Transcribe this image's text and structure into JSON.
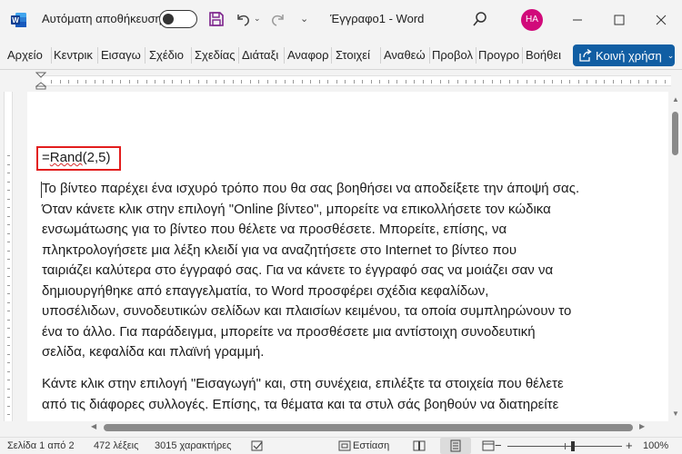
{
  "titlebar": {
    "autosave_label": "Αυτόματη αποθήκευση",
    "doc_title": "Έγγραφο1  -  Word",
    "avatar_initials": "HA",
    "avatar_color": "#d10a7a"
  },
  "ribbon": {
    "tabs": [
      "Αρχείο",
      "Κεντρικ",
      "Εισαγω",
      "Σχέδιο",
      "Σχεδίας",
      "Διάταξι",
      "Αναφορ",
      "Στοιχεί",
      "Αναθεώ",
      "Προβολ",
      "Προγρο",
      "Βοήθει"
    ],
    "share_label": "Κοινή χρήση",
    "share_color": "#115ea3"
  },
  "document": {
    "formula": "=Rand(2,5)",
    "formula_func": "Rand",
    "formula_args": "(2,5)",
    "paragraph1_lines": [
      "Το βίντεο παρέχει ένα ισχυρό τρόπο που θα σας βοηθήσει να αποδείξετε την άποψή σας.",
      "Όταν κάνετε κλικ στην επιλογή \"Online βίντεο\", μπορείτε να επικολλήσετε τον κώδικα",
      "ενσωμάτωσης για το βίντεο που θέλετε να προσθέσετε. Μπορείτε, επίσης, να",
      "πληκτρολογήσετε μια λέξη κλειδί για να αναζητήσετε στο Internet το βίντεο που",
      "ταιριάζει καλύτερα στο έγγραφό σας. Για να κάνετε το έγγραφό σας να μοιάζει σαν να",
      "δημιουργήθηκε από επαγγελματία, το Word προσφέρει σχέδια κεφαλίδων,",
      "υποσέλιδων, συνοδευτικών σελίδων και πλαισίων κειμένου, τα οποία συμπληρώνουν το",
      "ένα το άλλο. Για παράδειγμα, μπορείτε να προσθέσετε μια αντίστοιχη συνοδευτική",
      "σελίδα, κεφαλίδα και πλαϊνή γραμμή."
    ],
    "paragraph2_lines": [
      "Κάντε κλικ στην επιλογή \"Εισαγωγή\" και, στη συνέχεια, επιλέξτε τα στοιχεία που θέλετε",
      "από τις διάφορες συλλογές. Επίσης, τα θέματα και τα στυλ σάς βοηθούν να διατηρείτε"
    ]
  },
  "statusbar": {
    "page": "Σελίδα 1 από 2",
    "words": "472 λέξεις",
    "chars": "3015 χαρακτήρες",
    "focus": "Εστίαση",
    "zoom_minus": "−",
    "zoom_plus": "+",
    "zoom": "100%"
  }
}
